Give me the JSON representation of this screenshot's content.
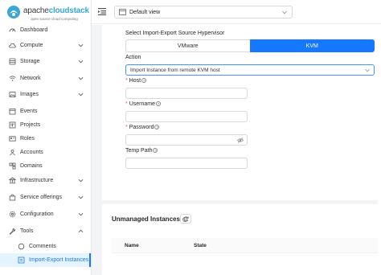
{
  "brand": {
    "name_part1": "apache",
    "name_part2": "cloudstack",
    "tagline": "open source cloud computing",
    "accent_color": "#39a7d8"
  },
  "sidebar": {
    "items": [
      {
        "label": "Dashboard",
        "icon": "dashboard-icon",
        "has_children": false
      },
      {
        "label": "Compute",
        "icon": "cloud-icon",
        "has_children": true
      },
      {
        "label": "Storage",
        "icon": "database-icon",
        "has_children": true
      },
      {
        "label": "Network",
        "icon": "wifi-icon",
        "has_children": true
      },
      {
        "label": "Images",
        "icon": "picture-icon",
        "has_children": true
      },
      {
        "label": "Events",
        "icon": "schedule-icon",
        "has_children": false
      },
      {
        "label": "Projects",
        "icon": "project-icon",
        "has_children": false
      },
      {
        "label": "Roles",
        "icon": "idcard-icon",
        "has_children": false
      },
      {
        "label": "Accounts",
        "icon": "team-icon",
        "has_children": false
      },
      {
        "label": "Domains",
        "icon": "block-icon",
        "has_children": false
      },
      {
        "label": "Infrastructure",
        "icon": "bank-icon",
        "has_children": true
      },
      {
        "label": "Service offerings",
        "icon": "shopping-icon",
        "has_children": true
      },
      {
        "label": "Configuration",
        "icon": "setting-icon",
        "has_children": true
      },
      {
        "label": "Tools",
        "icon": "tool-icon",
        "has_children": true
      }
    ],
    "sub_items": [
      {
        "label": "Comments",
        "icon": "message-icon",
        "active": false
      },
      {
        "label": "Import-Export Instances",
        "icon": "import-icon",
        "active": true
      }
    ],
    "active_color": "#1677ff"
  },
  "topbar": {
    "view_select_value": "Default view"
  },
  "form": {
    "hypervisor_label": "Select Import-Export Source Hypervisor",
    "hypervisor_options": [
      "VMware",
      "KVM"
    ],
    "hypervisor_selected": "KVM",
    "action_label": "Action",
    "action_value": "Import Instance from remote KVM host",
    "host_label": "Host",
    "host_value": "",
    "username_label": "Username",
    "username_value": "",
    "password_label": "Password",
    "password_value": "",
    "temp_path_label": "Temp Path",
    "temp_path_value": ""
  },
  "unmanaged": {
    "title": "Unmanaged Instances",
    "columns": [
      "Name",
      "State"
    ]
  }
}
